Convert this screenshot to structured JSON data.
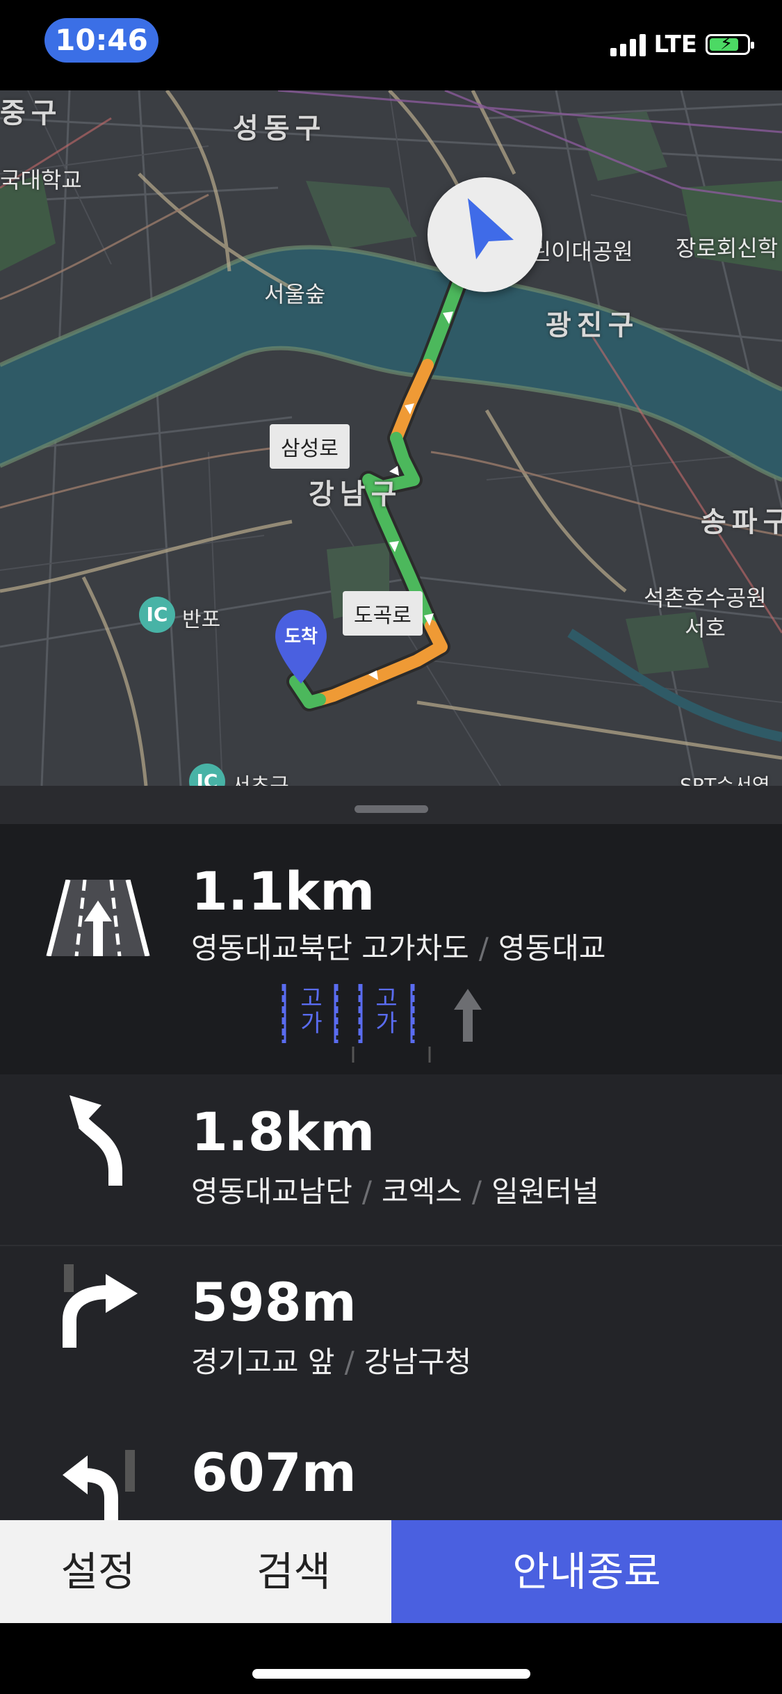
{
  "status_bar": {
    "time": "10:46",
    "network": "LTE"
  },
  "map": {
    "labels": {
      "seongdong": "성동구",
      "junggu": "중구",
      "konkuk": "국대학교",
      "seoul_forest": "서울숲",
      "childrens_park": "어린이대공원",
      "jangro": "장로회신학",
      "gwangjin": "광진구",
      "gangnam": "강남구",
      "songpa": "송파구",
      "seokchon": "석촌호수공원",
      "seoho": "서호",
      "banpo": "반포",
      "seocho": "서초구",
      "srt": "SRT수서역"
    },
    "road_signs": {
      "samseong": "삼성로",
      "dogok": "도곡로"
    },
    "ic_badge": "IC",
    "arrival": "도착"
  },
  "guidance": {
    "steps": [
      {
        "distance": "1.1km",
        "names": [
          "영동대교북단 고가차도",
          "영동대교"
        ]
      },
      {
        "distance": "1.8km",
        "names": [
          "영동대교남단",
          "코엑스",
          "일원터널"
        ]
      },
      {
        "distance": "598m",
        "names": [
          "경기고교 앞",
          "강남구청"
        ]
      },
      {
        "distance": "607m",
        "names": []
      }
    ],
    "lane_labels": [
      "고가",
      "고가"
    ]
  },
  "bottom_bar": {
    "settings": "설정",
    "search": "검색",
    "end_guidance": "안내종료"
  },
  "colors": {
    "route_green": "#4cb85c",
    "route_orange": "#ef9a35",
    "accent": "#4a60e0",
    "time_pill": "#3b6fe6"
  }
}
